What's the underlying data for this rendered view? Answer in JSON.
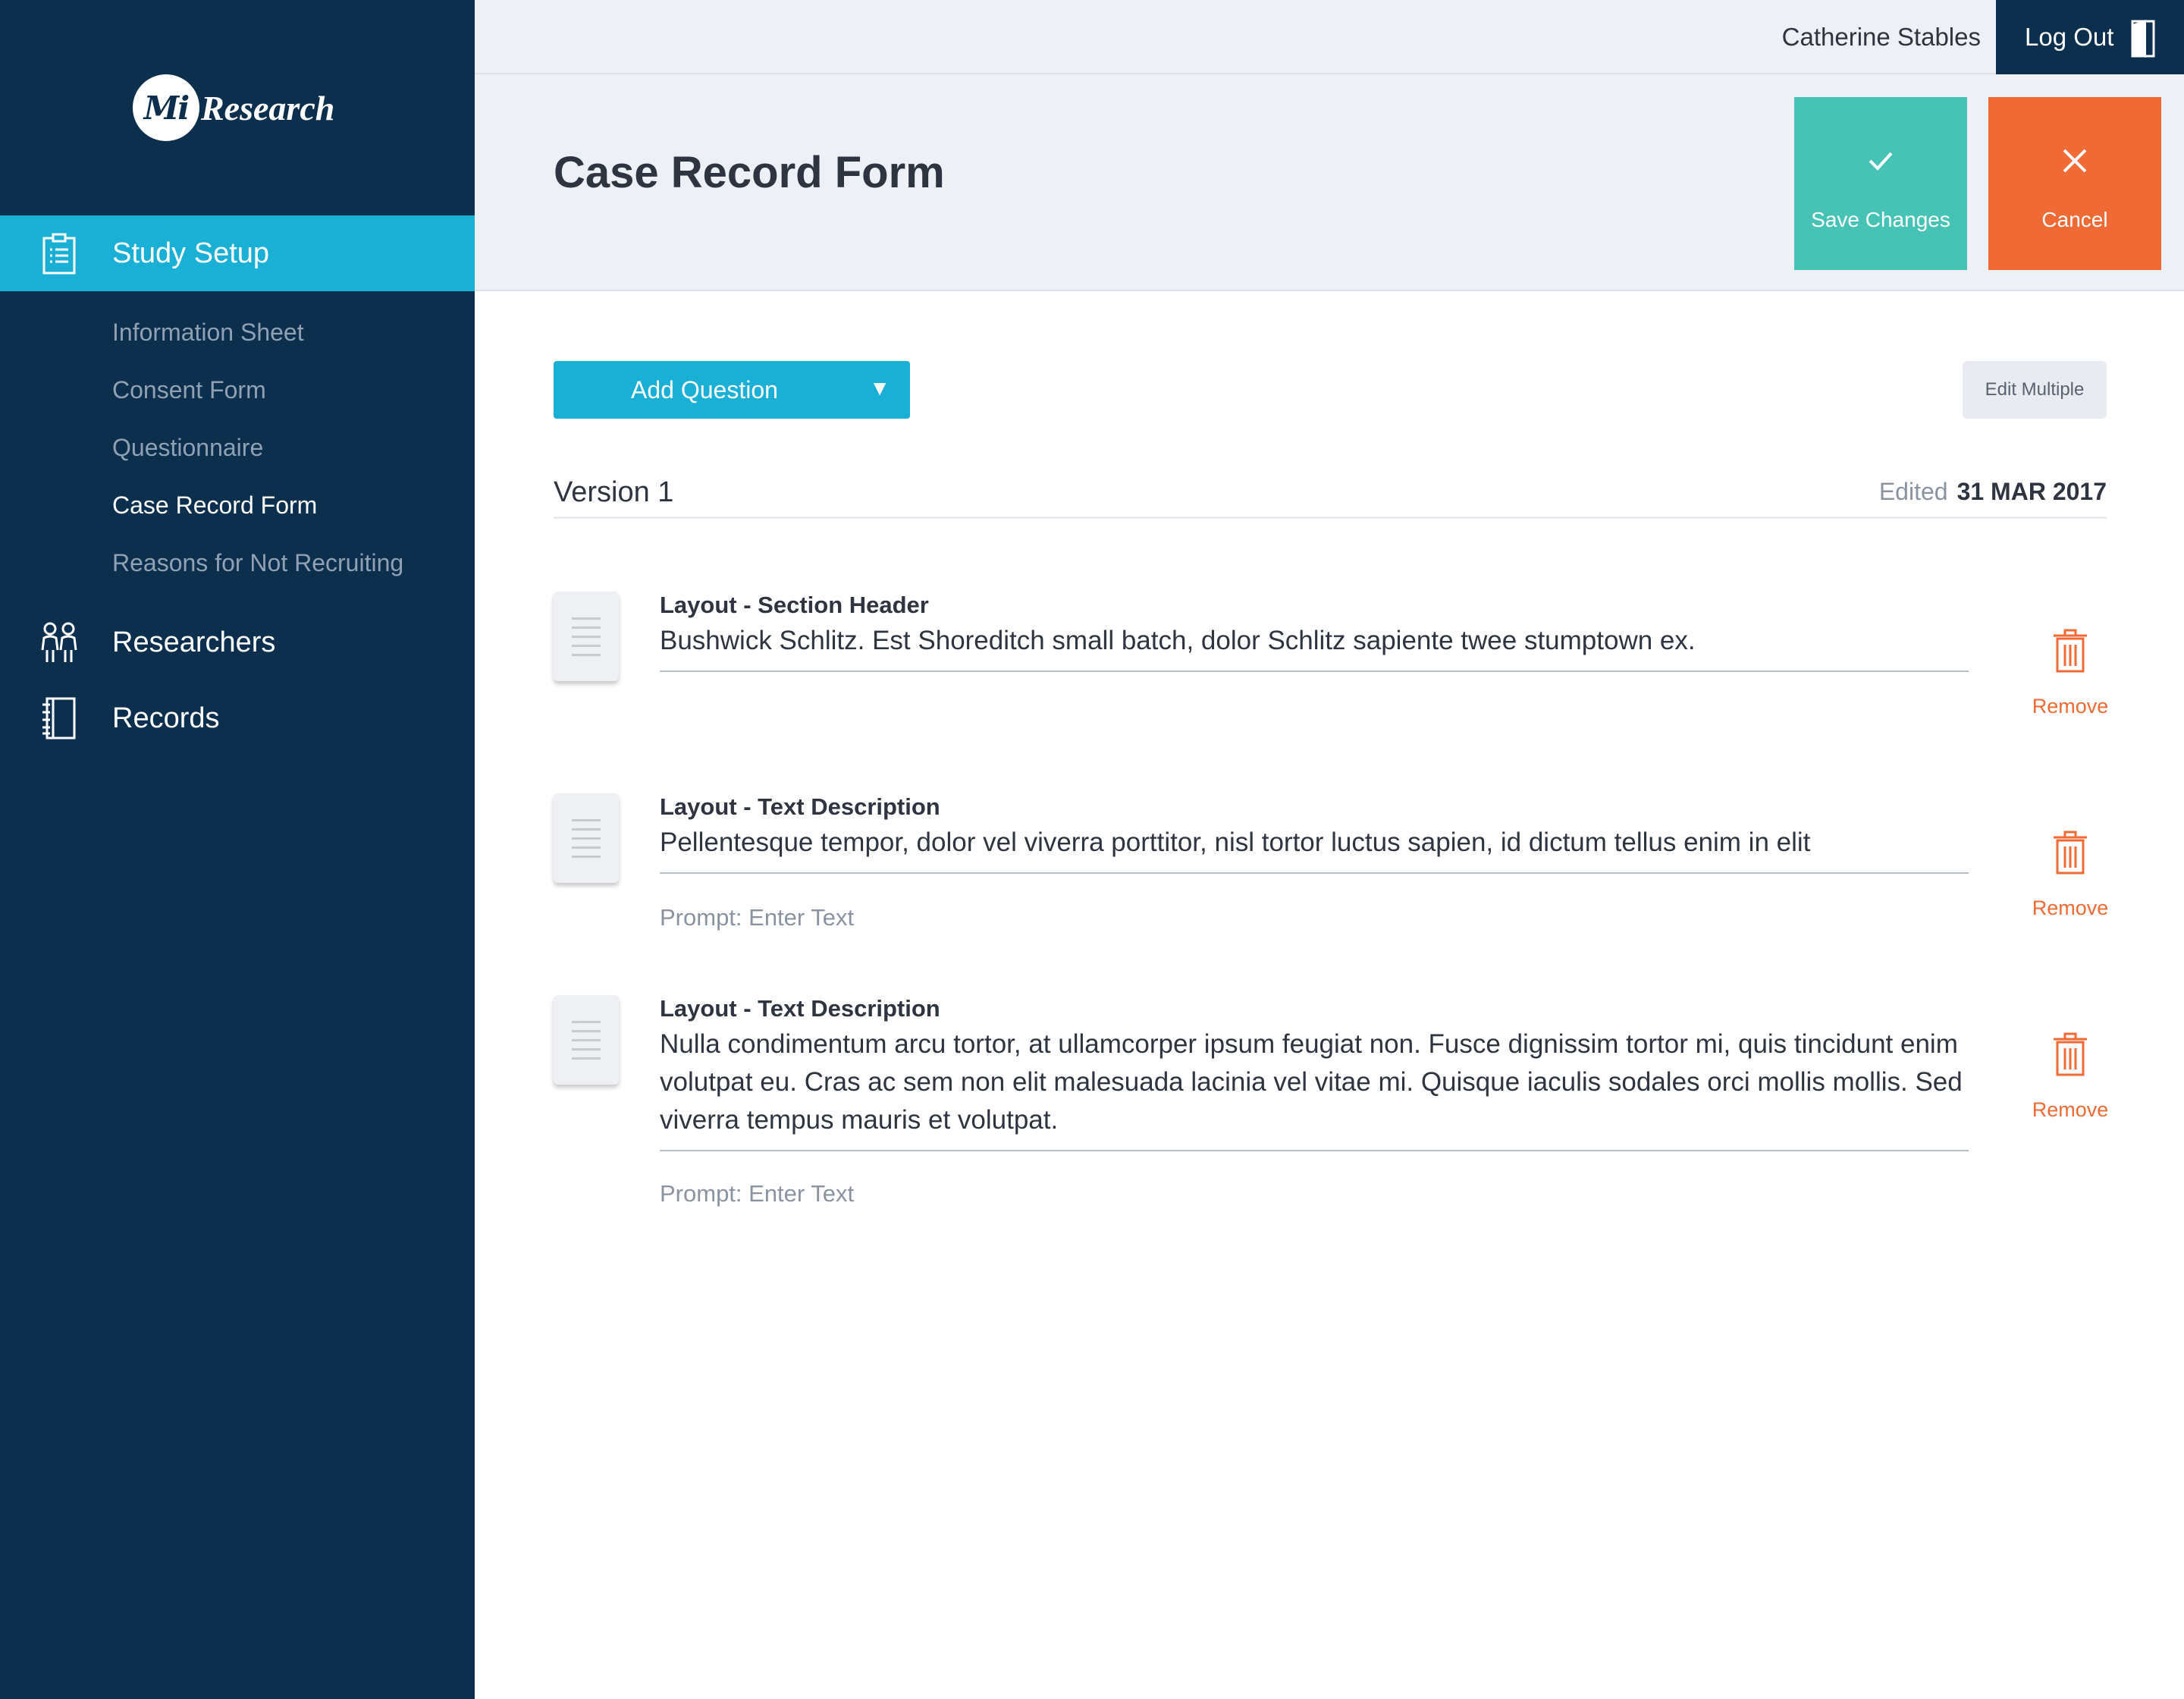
{
  "sidebar": {
    "logo_mark": "Mi",
    "logo_text": "Research",
    "active_item": "Study Setup",
    "sub_items": [
      {
        "label": "Information Sheet"
      },
      {
        "label": "Consent Form"
      },
      {
        "label": "Questionnaire"
      },
      {
        "label": "Case Record Form"
      },
      {
        "label": "Reasons for Not Recruiting"
      }
    ],
    "items": [
      {
        "label": "Researchers"
      },
      {
        "label": "Records"
      }
    ]
  },
  "topbar": {
    "user_name": "Catherine Stables",
    "logout_label": "Log Out"
  },
  "header": {
    "title": "Case Record Form",
    "save_label": "Save Changes",
    "cancel_label": "Cancel"
  },
  "toolbar": {
    "add_question_label": "Add Question",
    "edit_multiple_label": "Edit Multiple"
  },
  "version": {
    "label": "Version 1",
    "edited_label": "Edited",
    "edited_date": "31 MAR 2017"
  },
  "questions": [
    {
      "type": "Layout - Section Header",
      "text": "Bushwick Schlitz. Est Shoreditch small batch, dolor Schlitz sapiente twee stumptown ex.",
      "remove_label": "Remove"
    },
    {
      "type": "Layout - Text Description",
      "text": "Pellentesque tempor, dolor vel viverra porttitor, nisl tortor luctus sapien, id dictum tellus enim in elit",
      "prompt": "Prompt: Enter Text",
      "remove_label": "Remove"
    },
    {
      "type": "Layout - Text Description",
      "text": "Nulla condimentum arcu tortor, at ullamcorper ipsum feugiat non. Fusce dignissim tortor mi, quis tincidunt enim volutpat eu. Cras ac sem non elit malesuada lacinia vel vitae mi. Quisque iaculis sodales orci mollis mollis. Sed viverra tempus mauris et volutpat.",
      "prompt": "Prompt: Enter Text",
      "remove_label": "Remove"
    }
  ],
  "colors": {
    "sidebar_bg": "#0b2f4c",
    "accent_blue": "#1aafd5",
    "save_green": "#46c3b5",
    "cancel_orange": "#ef6a34"
  },
  "icons": {
    "study_setup": "clipboard-icon",
    "researchers": "people-icon",
    "records": "notebook-icon",
    "logout": "door-icon",
    "save": "check-icon",
    "cancel": "close-icon",
    "remove": "trash-icon",
    "drag": "drag-handle-icon",
    "add_question_caret": "caret-down-icon"
  }
}
